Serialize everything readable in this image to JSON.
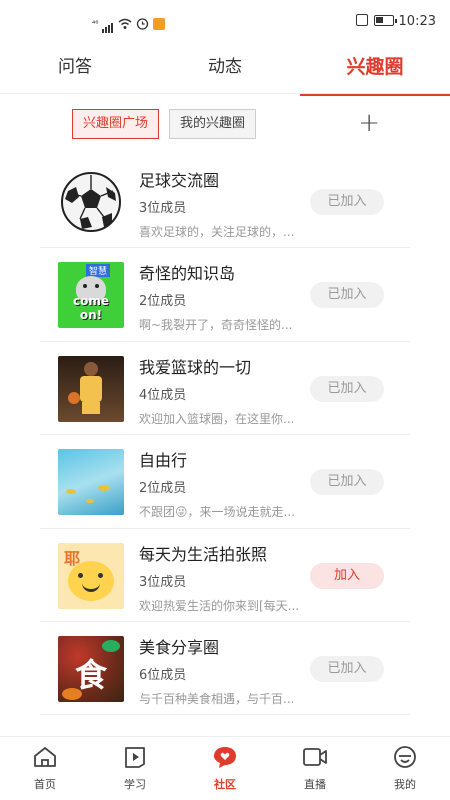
{
  "status_bar": {
    "time": "10:23",
    "network": "⁴⁶"
  },
  "top_tabs": [
    {
      "label": "问答",
      "active": false
    },
    {
      "label": "动态",
      "active": false
    },
    {
      "label": "兴趣圈",
      "active": true
    }
  ],
  "filters": {
    "plaza_label": "兴趣圈广场",
    "mine_label": "我的兴趣圈",
    "add_label": "+"
  },
  "circles": [
    {
      "name": "足球交流圈",
      "members": "3位成员",
      "desc": "喜欢足球的，关注足球的，...",
      "action": "已加入",
      "joined": true,
      "thumb": "soccer-ball"
    },
    {
      "name": "奇怪的知识岛",
      "members": "2位成员",
      "desc": "啊~我裂开了，奇奇怪怪的...",
      "action": "已加入",
      "joined": true,
      "thumb": "husky-meme"
    },
    {
      "name": "我爱篮球的一切",
      "members": "4位成员",
      "desc": "欢迎加入篮球圈，在这里你...",
      "action": "已加入",
      "joined": true,
      "thumb": "basketball-player"
    },
    {
      "name": "自由行",
      "members": "2位成员",
      "desc": "不跟团😜，来一场说走就走...",
      "action": "已加入",
      "joined": true,
      "thumb": "sea-water"
    },
    {
      "name": "每天为生活拍张照",
      "members": "3位成员",
      "desc": "欢迎热爱生活的你来到[每天...",
      "action": "加入",
      "joined": false,
      "thumb": "cartoon-face"
    },
    {
      "name": "美食分享圈",
      "members": "6位成员",
      "desc": "与千百种美食相遇，与千百...",
      "action": "已加入",
      "joined": true,
      "thumb": "food"
    }
  ],
  "thumb_text": {
    "husky_top": "智慧",
    "husky_main": "come on!",
    "cartoon": "耶",
    "food": "食"
  },
  "bottom_nav": [
    {
      "label": "首页",
      "icon": "home-icon",
      "active": false
    },
    {
      "label": "学习",
      "icon": "play-icon",
      "active": false
    },
    {
      "label": "社区",
      "icon": "community-icon",
      "active": true
    },
    {
      "label": "直播",
      "icon": "video-icon",
      "active": false
    },
    {
      "label": "我的",
      "icon": "profile-icon",
      "active": false
    }
  ],
  "colors": {
    "accent": "#e03c2e",
    "joined_bg": "#f1f1f1",
    "join_bg": "#fbe3e3"
  }
}
